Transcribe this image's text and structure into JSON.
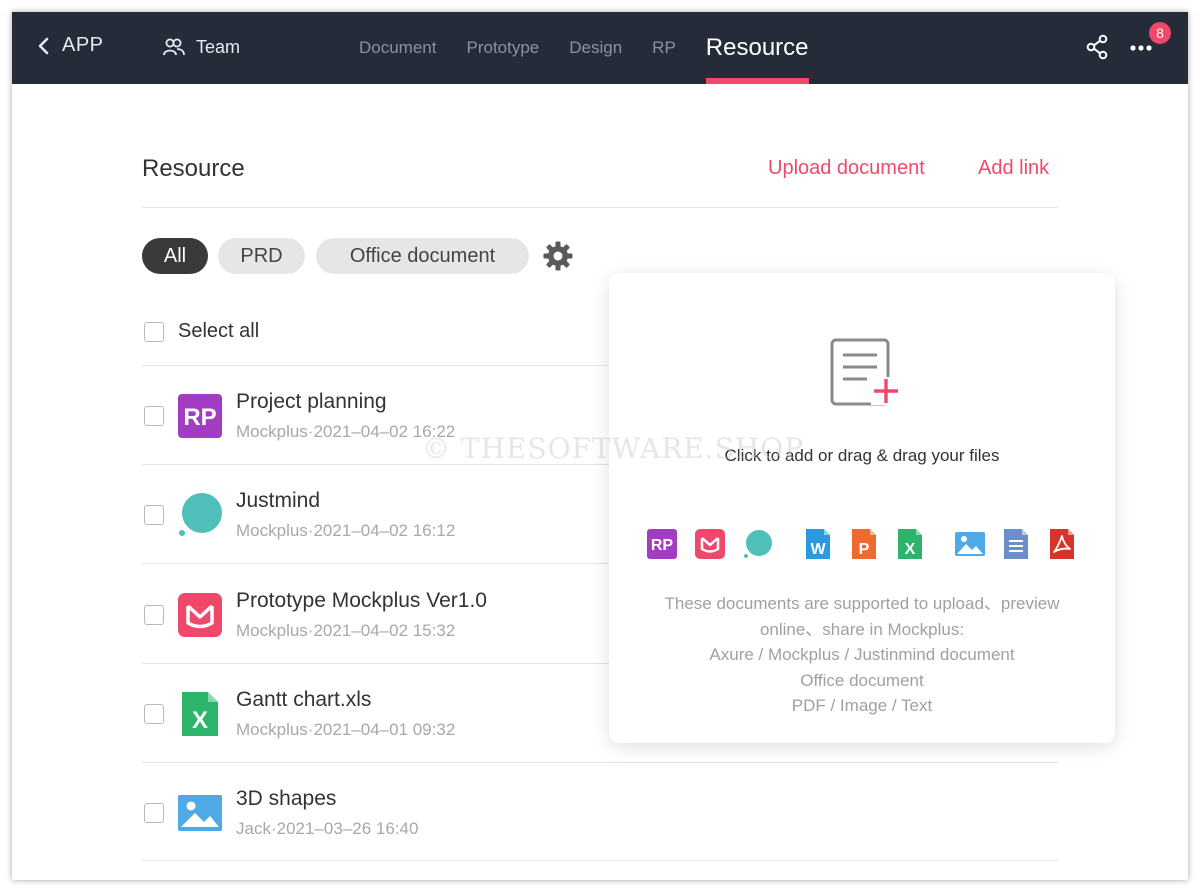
{
  "topbar": {
    "back_label": "APP",
    "team_label": "Team",
    "tabs": [
      {
        "label": "Document"
      },
      {
        "label": "Prototype"
      },
      {
        "label": "Design"
      },
      {
        "label": "RP"
      },
      {
        "label": "Resource"
      }
    ],
    "active_tab": "Resource",
    "notification_count": "8",
    "accent_color": "#f0486b",
    "bar_color": "#262b3a"
  },
  "header": {
    "title": "Resource",
    "upload_label": "Upload document",
    "add_link_label": "Add link"
  },
  "filters": {
    "pills": [
      {
        "label": "All"
      },
      {
        "label": "PRD"
      },
      {
        "label": "Office document"
      }
    ],
    "active": "All",
    "settings_icon": "gear-icon"
  },
  "list": {
    "select_all_label": "Select all",
    "items": [
      {
        "name": "Project planning",
        "meta": "Mockplus·2021–04–02 16:22",
        "icon": "axure-rp-icon"
      },
      {
        "name": "Justmind",
        "meta": "Mockplus·2021–04–02 16:12",
        "icon": "justinmind-icon"
      },
      {
        "name": "Prototype Mockplus Ver1.0",
        "meta": "Mockplus·2021–04–02 15:32",
        "icon": "mockplus-icon"
      },
      {
        "name": "Gantt chart.xls",
        "meta": "Mockplus·2021–04–01 09:32",
        "icon": "excel-icon"
      },
      {
        "name": "3D shapes",
        "meta": "Jack·2021–03–26 16:40",
        "icon": "image-icon"
      }
    ]
  },
  "upload_panel": {
    "hint": "Click to add or drag & drag your files",
    "type_icons": [
      "axure-rp-icon",
      "mockplus-icon",
      "justinmind-icon",
      "word-icon",
      "powerpoint-icon",
      "excel-icon",
      "image-icon",
      "text-icon",
      "pdf-icon"
    ],
    "support_lines": [
      "These documents are supported to upload、preview",
      "online、share in Mockplus:",
      "Axure / Mockplus / Justinmind document",
      "Office document",
      "PDF / Image / Text"
    ]
  },
  "watermark": "© THESOFTWARE.SHOP"
}
